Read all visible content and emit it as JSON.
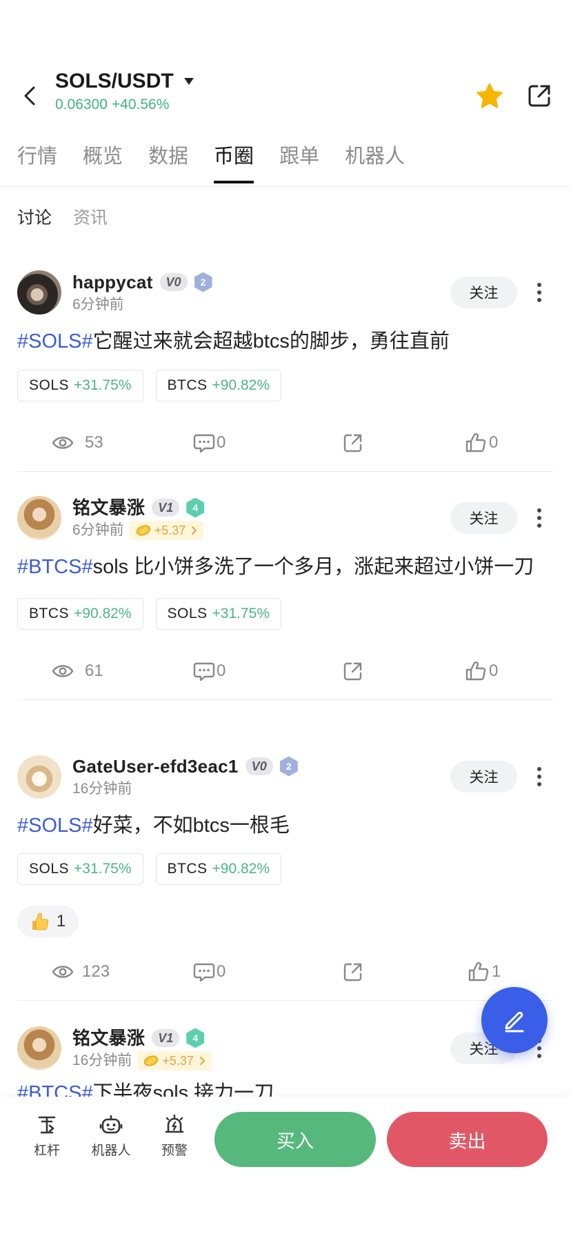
{
  "header": {
    "pair": "SOLS/USDT",
    "price": "0.06300",
    "change": "+40.56%",
    "favorite_icon": "star-icon",
    "share_icon": "share-icon"
  },
  "tabs": [
    "行情",
    "概览",
    "数据",
    "币圈",
    "跟单",
    "机器人"
  ],
  "active_tab": "币圈",
  "subtabs": [
    "讨论",
    "资讯"
  ],
  "active_subtab": "讨论",
  "follow_label": "关注",
  "posts": [
    {
      "name": "happycat",
      "vip": "V0",
      "level": "2",
      "time": "6分钟前",
      "hashtag": "#SOLS#",
      "text": "它醒过来就会超越btcs的脚步，勇往直前",
      "tags": [
        {
          "symbol": "SOLS",
          "change": "+31.75%"
        },
        {
          "symbol": "BTCS",
          "change": "+90.82%"
        }
      ],
      "views": "53",
      "comments": "0",
      "likes": "0"
    },
    {
      "name": "铭文暴涨",
      "vip": "V1",
      "level": "4",
      "time": "6分钟前",
      "reward": "+5.37",
      "hashtag": "#BTCS#",
      "text": "sols 比小饼多洗了一个多月，涨起来超过小饼一刀",
      "tags": [
        {
          "symbol": "BTCS",
          "change": "+90.82%"
        },
        {
          "symbol": "SOLS",
          "change": "+31.75%"
        }
      ],
      "views": "61",
      "comments": "0",
      "likes": "0"
    },
    {
      "name": "GateUser-efd3eac1",
      "vip": "V0",
      "level": "2",
      "time": "16分钟前",
      "hashtag": "#SOLS#",
      "text": "好菜，不如btcs一根毛",
      "tags": [
        {
          "symbol": "SOLS",
          "change": "+31.75%"
        },
        {
          "symbol": "BTCS",
          "change": "+90.82%"
        }
      ],
      "reactions": [
        {
          "icon": "thumbs-up-emoji",
          "count": "1"
        }
      ],
      "views": "123",
      "comments": "0",
      "likes": "1"
    },
    {
      "name": "铭文暴涨",
      "vip": "V1",
      "level": "4",
      "time": "16分钟前",
      "reward": "+5.37",
      "hashtag": "#BTCS#",
      "text": "下半夜sols 接力一刀"
    }
  ],
  "fab": {
    "icon": "pencil-icon"
  },
  "bottom_bar": {
    "tools": [
      {
        "label": "杠杆",
        "icon": "leverage-icon"
      },
      {
        "label": "机器人",
        "icon": "robot-icon"
      },
      {
        "label": "预警",
        "icon": "alarm-icon"
      }
    ],
    "buy_label": "买入",
    "sell_label": "卖出"
  },
  "colors": {
    "up_green": "#3fb37a",
    "buy_green": "#56b87c",
    "sell_red": "#e25766",
    "hashtag_blue": "#3a5bd9",
    "fab_blue": "#3a5ee8",
    "star_yellow": "#f7b500"
  }
}
